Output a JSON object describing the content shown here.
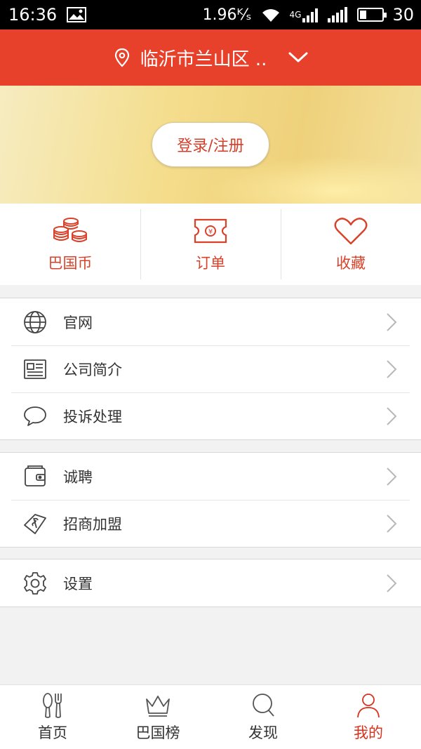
{
  "status_bar": {
    "time": "16:36",
    "speed": "1.96ᴷ⁄ₛ",
    "network": "4G",
    "battery": "30"
  },
  "header": {
    "location": "临沂市兰山区 .."
  },
  "banner": {
    "login_label": "登录/注册"
  },
  "quick_actions": [
    {
      "label": "巴国币",
      "icon": "coins-icon"
    },
    {
      "label": "订单",
      "icon": "ticket-icon"
    },
    {
      "label": "收藏",
      "icon": "heart-icon"
    }
  ],
  "menu_groups": [
    [
      {
        "label": "官网",
        "icon": "globe-icon"
      },
      {
        "label": "公司简介",
        "icon": "newspaper-icon"
      },
      {
        "label": "投诉处理",
        "icon": "chat-bubble-icon"
      }
    ],
    [
      {
        "label": "诚聘",
        "icon": "wallet-icon"
      },
      {
        "label": "招商加盟",
        "icon": "money-tag-icon"
      }
    ],
    [
      {
        "label": "设置",
        "icon": "gear-icon"
      }
    ]
  ],
  "tabbar": [
    {
      "label": "首页",
      "icon": "cutlery-icon"
    },
    {
      "label": "巴国榜",
      "icon": "crown-icon"
    },
    {
      "label": "发现",
      "icon": "search-icon"
    },
    {
      "label": "我的",
      "icon": "user-icon",
      "active": true
    }
  ],
  "colors": {
    "brand_red": "#e8412b",
    "accent_text": "#d94129",
    "status_bar": "#000000"
  }
}
